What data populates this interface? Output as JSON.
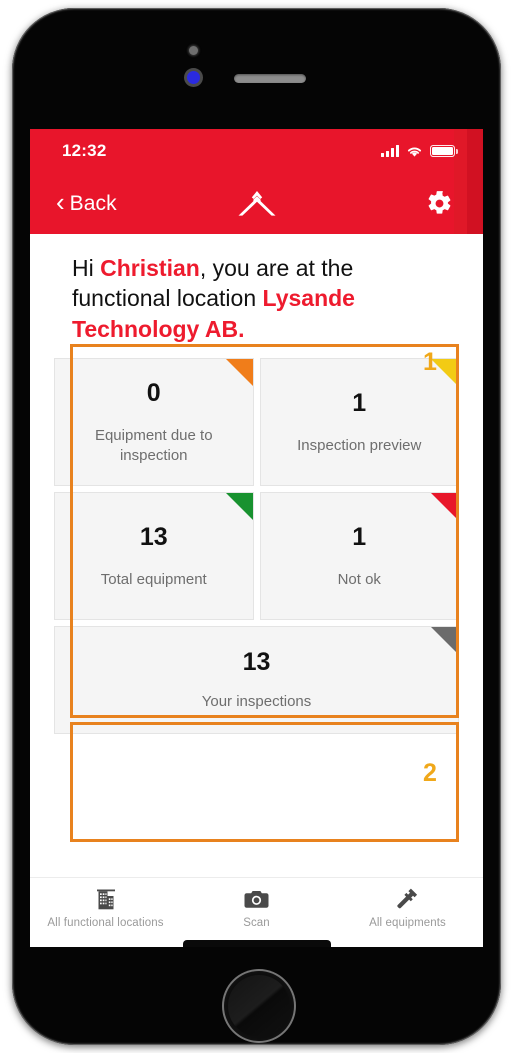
{
  "status_bar": {
    "time": "12:32",
    "signal_icon": "cellular-signal-icon",
    "wifi_icon": "wifi-icon",
    "battery_icon": "battery-icon"
  },
  "nav_bar": {
    "back_label": "Back",
    "back_icon": "chevron-left-icon",
    "logo_icon": "app-logo-icon",
    "settings_icon": "gear-icon"
  },
  "greeting": {
    "part1": "Hi ",
    "name": "Christian",
    "part2": ", you are at the functional location ",
    "location": "Lysande Technology AB."
  },
  "annotations": {
    "marker_1": "1",
    "marker_2": "2",
    "color": "#e8821e",
    "number_color": "#f0a81a"
  },
  "tiles": [
    {
      "value": "0",
      "label": "Equipment due to inspection",
      "corner_color": "#f07d1a",
      "corner_name": "orange-corner-marker"
    },
    {
      "value": "1",
      "label": "Inspection preview",
      "corner_color": "#f2cb14",
      "corner_name": "yellow-corner-marker"
    },
    {
      "value": "13",
      "label": "Total equipment",
      "corner_color": "#18922f",
      "corner_name": "green-corner-marker"
    },
    {
      "value": "1",
      "label": "Not ok",
      "corner_color": "#e8172a",
      "corner_name": "red-corner-marker"
    }
  ],
  "wide_tile": {
    "value": "13",
    "label": "Your inspections",
    "corner_color": "#6b6b6b",
    "corner_name": "gray-corner-marker"
  },
  "tab_bar": [
    {
      "label": "All functional locations",
      "icon": "building-icon"
    },
    {
      "label": "Scan",
      "icon": "camera-icon"
    },
    {
      "label": "All equipments",
      "icon": "hammer-icon"
    }
  ],
  "theme": {
    "header_red": "#e8152b",
    "accent_red": "#ee1b2e",
    "tile_bg": "#f5f5f5"
  }
}
